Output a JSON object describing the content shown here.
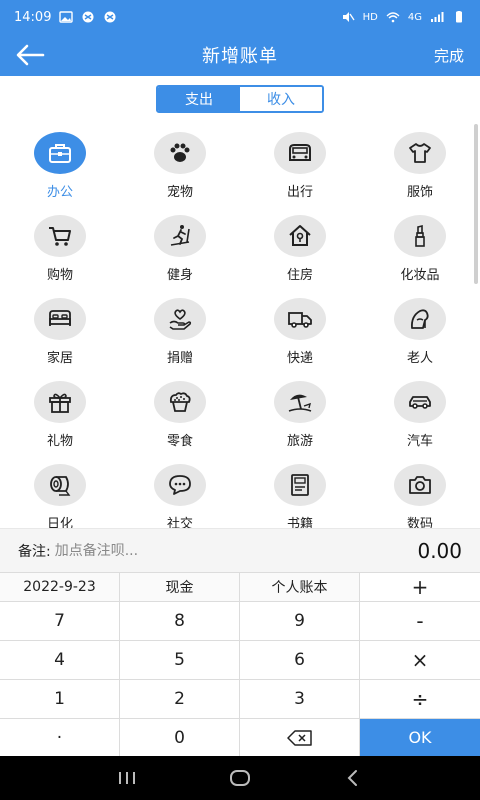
{
  "status_bar": {
    "time": "14:09",
    "network": "HD",
    "signal_label": "4G"
  },
  "header": {
    "title": "新增账单",
    "done_label": "完成"
  },
  "tabs": [
    {
      "label": "支出",
      "active": true
    },
    {
      "label": "收入",
      "active": false
    }
  ],
  "categories": [
    {
      "label": "办公",
      "icon": "briefcase-icon",
      "selected": true
    },
    {
      "label": "宠物",
      "icon": "paw-icon"
    },
    {
      "label": "出行",
      "icon": "car-front-icon"
    },
    {
      "label": "服饰",
      "icon": "shirt-icon"
    },
    {
      "label": "购物",
      "icon": "cart-icon"
    },
    {
      "label": "健身",
      "icon": "treadmill-icon"
    },
    {
      "label": "住房",
      "icon": "house-icon"
    },
    {
      "label": "化妆品",
      "icon": "lipstick-icon"
    },
    {
      "label": "家居",
      "icon": "bed-icon"
    },
    {
      "label": "捐赠",
      "icon": "heart-hand-icon"
    },
    {
      "label": "快递",
      "icon": "truck-icon"
    },
    {
      "label": "老人",
      "icon": "elder-icon"
    },
    {
      "label": "礼物",
      "icon": "gift-icon"
    },
    {
      "label": "零食",
      "icon": "muffin-icon"
    },
    {
      "label": "旅游",
      "icon": "beach-umbrella-icon"
    },
    {
      "label": "汽车",
      "icon": "car-icon"
    },
    {
      "label": "日化",
      "icon": "tissue-roll-icon"
    },
    {
      "label": "社交",
      "icon": "chat-icon"
    },
    {
      "label": "书籍",
      "icon": "book-icon"
    },
    {
      "label": "数码",
      "icon": "camera-icon"
    }
  ],
  "remark": {
    "label": "备注:",
    "placeholder": "加点备注呗...",
    "amount": "0.00"
  },
  "keypad": {
    "date": "2022-9-23",
    "account_type": "现金",
    "ledger": "个人账本",
    "plus": "+",
    "minus": "-",
    "multiply": "×",
    "divide": "÷",
    "k7": "7",
    "k8": "8",
    "k9": "9",
    "k4": "4",
    "k5": "5",
    "k6": "6",
    "k1": "1",
    "k2": "2",
    "k3": "3",
    "dot": "·",
    "k0": "0",
    "ok": "OK"
  },
  "colors": {
    "primary": "#3d8ee6",
    "circle_bg": "#e6e6e6"
  }
}
